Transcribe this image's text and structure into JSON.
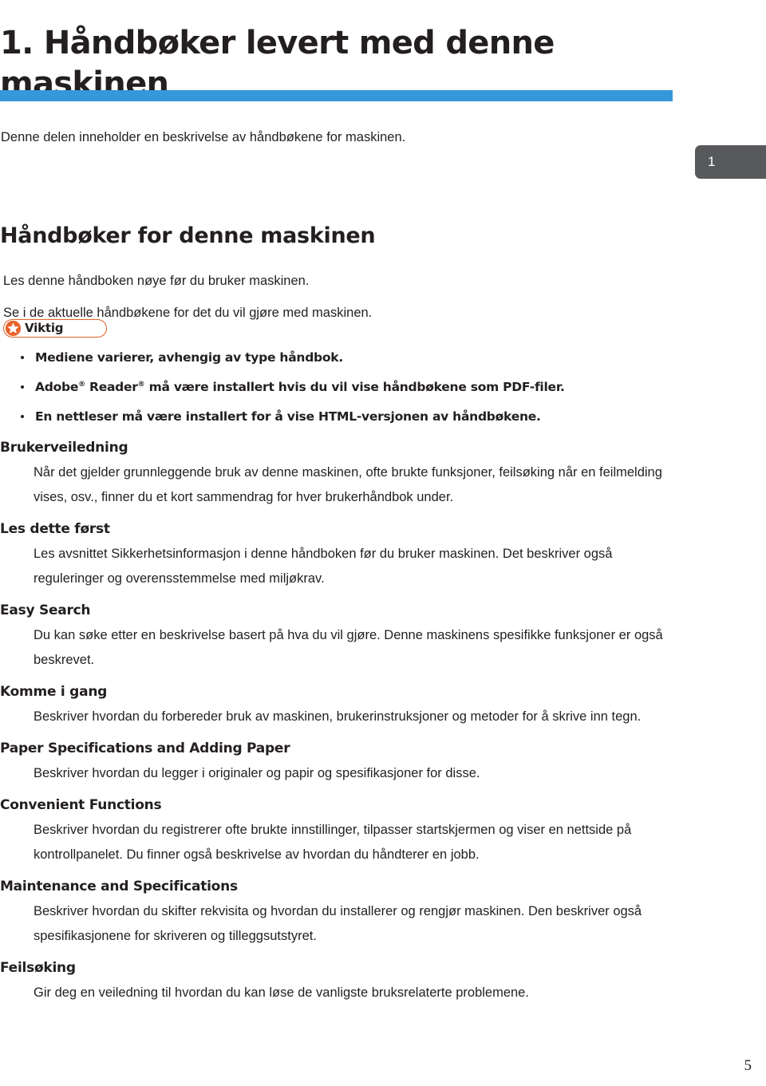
{
  "document": {
    "chapter_title": "1. Håndbøker levert med denne maskinen",
    "intro": "Denne delen inneholder en beskrivelse av håndbøkene for maskinen.",
    "page_tab": "1",
    "folio": "5",
    "accent_bar_color": "#3498db",
    "tab_color": "#58595b",
    "notice_color": "#e06328"
  },
  "section": {
    "title": "Håndbøker for denne maskinen",
    "lead_1": "Les denne håndboken nøye før du bruker maskinen.",
    "lead_2": "Se i de aktuelle håndbøkene for det du vil gjøre med maskinen."
  },
  "notice": {
    "label": "Viktig",
    "icon": "star-icon",
    "items": [
      "Mediene varierer, avhengig av type håndbok.",
      "Adobe ® Reader ® må være installert hvis du vil vise håndbøkene som PDF-filer.",
      "En nettleser må være installert for å vise HTML-versjonen av håndbøkene."
    ]
  },
  "manuals": [
    {
      "title": "Brukerveiledning",
      "body": "Når det gjelder grunnleggende bruk av denne maskinen, ofte brukte funksjoner, feilsøking når en feilmelding vises, osv., finner du et kort sammendrag for hver brukerhåndbok under."
    },
    {
      "title": "Les dette først",
      "body": "Les avsnittet Sikkerhetsinformasjon i denne håndboken før du bruker maskinen. Det beskriver også reguleringer og overensstemmelse med miljøkrav."
    },
    {
      "title": "Easy Search",
      "body": "Du kan søke etter en beskrivelse basert på hva du vil gjøre. Denne maskinens spesifikke funksjoner er også beskrevet."
    },
    {
      "title": "Komme i gang",
      "body": "Beskriver hvordan du forbereder bruk av maskinen, brukerinstruksjoner og metoder for å skrive inn tegn."
    },
    {
      "title": "Paper Specifications and Adding Paper",
      "body": "Beskriver hvordan du legger i originaler og papir og spesifikasjoner for disse."
    },
    {
      "title": "Convenient Functions",
      "body": "Beskriver hvordan du registrerer ofte brukte innstillinger, tilpasser startskjermen og viser en nettside på kontrollpanelet. Du finner også beskrivelse av hvordan du håndterer en jobb."
    },
    {
      "title": "Maintenance and Specifications",
      "body": "Beskriver hvordan du skifter rekvisita og hvordan du installerer og rengjør maskinen. Den beskriver også spesifikasjonene for skriveren og tilleggsutstyret."
    },
    {
      "title": "Feilsøking",
      "body": "Gir deg en veiledning til hvordan du kan løse de vanligste bruksrelaterte problemene."
    }
  ]
}
